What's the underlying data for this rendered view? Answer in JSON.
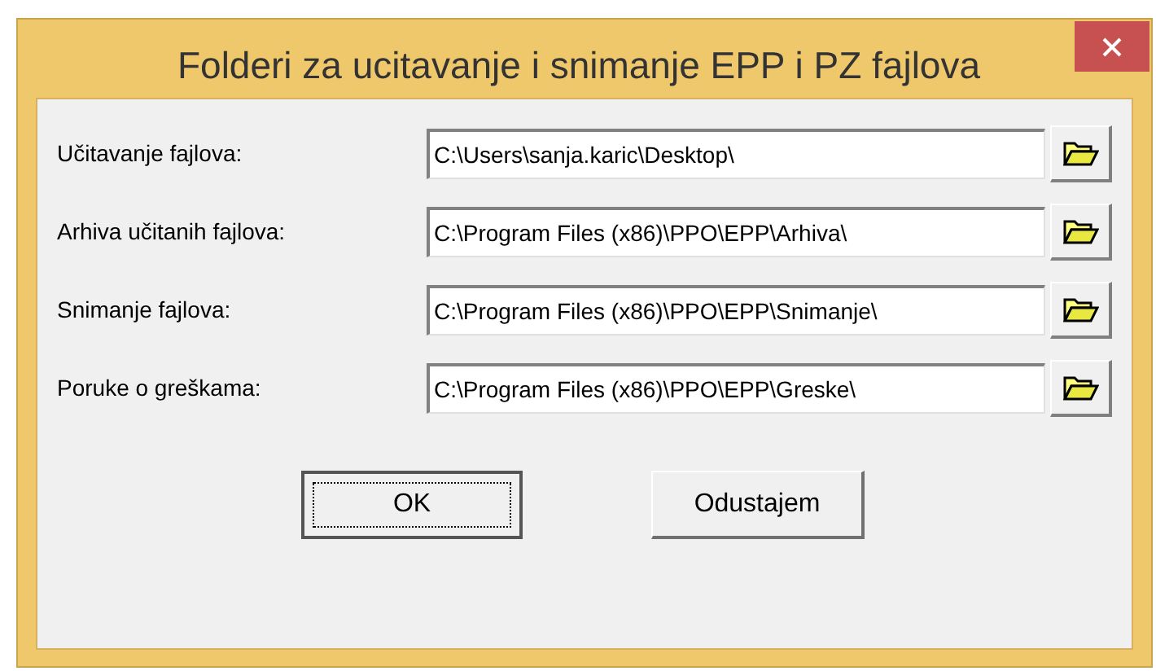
{
  "window": {
    "title": "Folderi za ucitavanje i snimanje EPP i PZ fajlova"
  },
  "fields": [
    {
      "label": "Učitavanje fajlova:",
      "value": "C:\\Users\\sanja.karic\\Desktop\\"
    },
    {
      "label": "Arhiva učitanih fajlova:",
      "value": "C:\\Program Files (x86)\\PPO\\EPP\\Arhiva\\"
    },
    {
      "label": "Snimanje fajlova:",
      "value": "C:\\Program Files (x86)\\PPO\\EPP\\Snimanje\\"
    },
    {
      "label": "Poruke o greškama:",
      "value": "C:\\Program Files (x86)\\PPO\\EPP\\Greske\\"
    }
  ],
  "buttons": [
    {
      "label": "OK",
      "focused": true
    },
    {
      "label": "Odustajem",
      "focused": false
    }
  ]
}
